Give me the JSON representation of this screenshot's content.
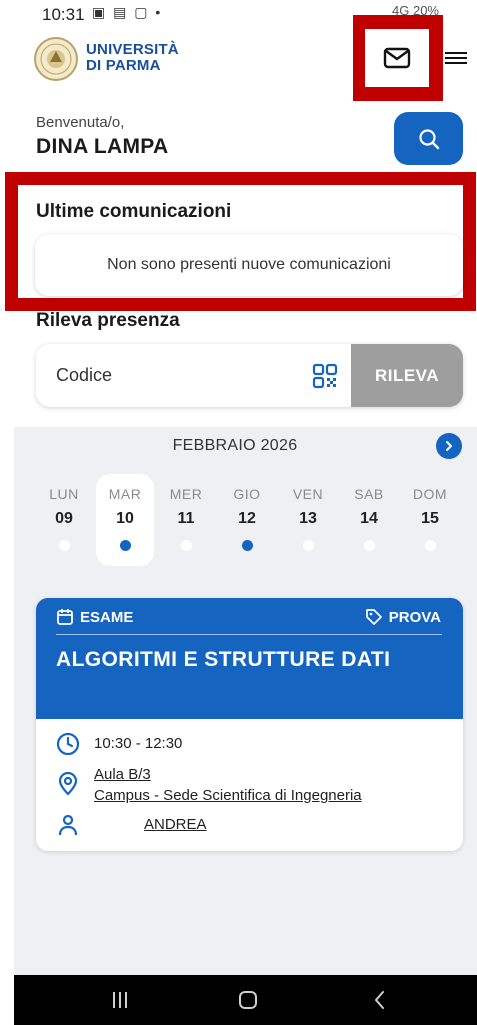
{
  "status_bar": {
    "time": "10:31",
    "left_icons": "▣ ▤ ▢ •",
    "right": "4G 20%"
  },
  "header": {
    "university_line1": "UNIVERSITÀ",
    "university_line2": "DI PARMA",
    "icons": [
      "university-logo",
      "mail-icon",
      "menu-icon"
    ]
  },
  "welcome": {
    "label": "Benvenuta/o,",
    "user_name": "DINA LAMPA"
  },
  "communications": {
    "title": "Ultime comunicazioni",
    "empty_message": "Non sono presenti nuove comunicazioni"
  },
  "presence": {
    "title": "Rileva presenza",
    "code_placeholder": "Codice",
    "button_label": "RILEVA"
  },
  "calendar": {
    "month": "FEBBRAIO 2026",
    "days": [
      {
        "name": "LUN",
        "num": "09",
        "has_event": false,
        "selected": false
      },
      {
        "name": "MAR",
        "num": "10",
        "has_event": true,
        "selected": true
      },
      {
        "name": "MER",
        "num": "11",
        "has_event": false,
        "selected": false
      },
      {
        "name": "GIO",
        "num": "12",
        "has_event": true,
        "selected": false
      },
      {
        "name": "VEN",
        "num": "13",
        "has_event": false,
        "selected": false
      },
      {
        "name": "SAB",
        "num": "14",
        "has_event": false,
        "selected": false
      },
      {
        "name": "DOM",
        "num": "15",
        "has_event": false,
        "selected": false
      }
    ]
  },
  "event": {
    "type": "ESAME",
    "tag": "PROVA",
    "title": "ALGORITMI E STRUTTURE DATI",
    "time": "10:30 - 12:30",
    "room": "Aula B/3",
    "location": "Campus - Sede Scientifica di Ingegneria",
    "teacher": "ANDREA"
  },
  "colors": {
    "primary": "#1565c0",
    "highlight": "#c00000",
    "disabled_button": "#9e9e9e",
    "calendar_bg": "#eef0f4"
  }
}
